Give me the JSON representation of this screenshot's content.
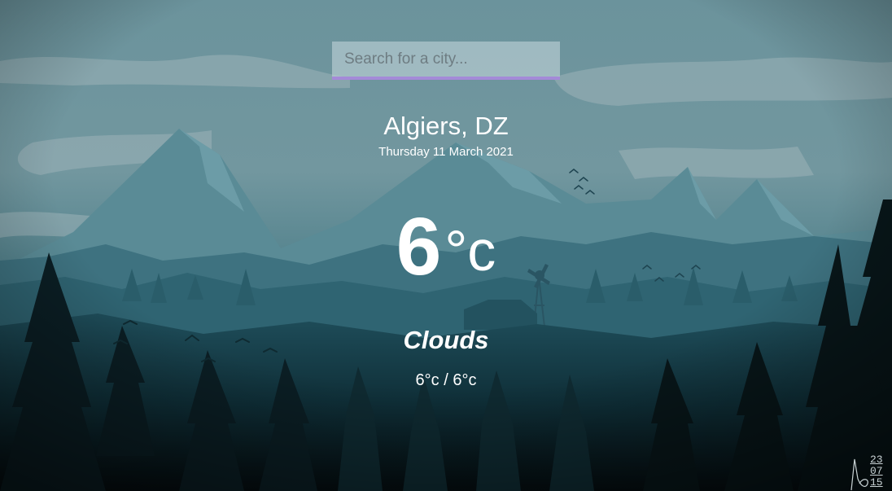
{
  "search": {
    "placeholder": "Search for a city..."
  },
  "weather": {
    "location": "Algiers, DZ",
    "date": "Thursday 11 March 2021",
    "temperature": "6",
    "unit": "°c",
    "condition": "Clouds",
    "hi_lo": "6°c / 6°c"
  },
  "background": {
    "scene": "mountain-forest-landscape",
    "colors": {
      "sky": "#6b939c",
      "mountain_far": "#5e8f9a",
      "forest_mid": "#2f6270",
      "forest_dark": "#10303a",
      "accent_underline": "#a48ad8"
    }
  },
  "signature": {
    "digits": "23 07 15"
  }
}
